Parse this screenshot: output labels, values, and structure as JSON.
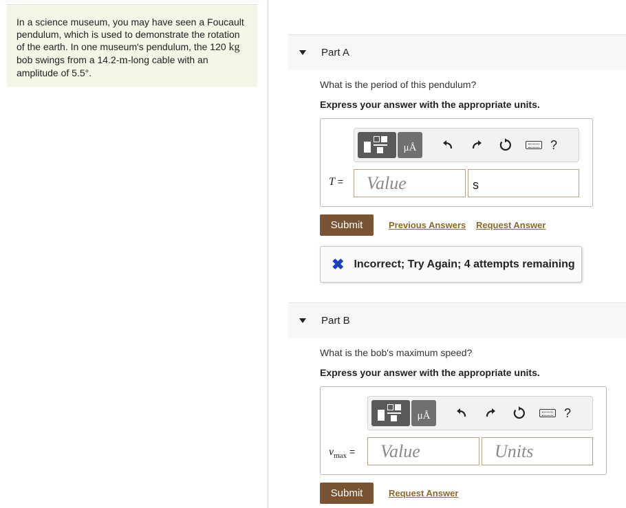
{
  "problem": {
    "text_1": "In a science museum, you may have seen a Foucault pendulum, which is used to demonstrate the rotation of the earth. In one museum's pendulum, the 120 ",
    "unit_kg": "kg",
    "text_2": " bob swings from a ",
    "length": "14.2-",
    "unit_m": "m",
    "text_3": "-long cable with an amplitude of 5.5°."
  },
  "part_a": {
    "title": "Part A",
    "question": "What is the period of this pendulum?",
    "instruction": "Express your answer with the appropriate units.",
    "var_symbol": "T",
    "var_eq": " =",
    "value_placeholder": "Value",
    "unit_value": "s",
    "submit_label": "Submit",
    "previous_answers_label": "Previous Answers",
    "request_answer_label": "Request Answer",
    "feedback": "Incorrect; Try Again; 4 attempts remaining"
  },
  "part_b": {
    "title": "Part B",
    "question": "What is the bob's maximum speed?",
    "instruction": "Express your answer with the appropriate units.",
    "var_symbol": "v",
    "var_sub": "max",
    "var_eq": " =",
    "value_placeholder": "Value",
    "units_placeholder": "Units",
    "submit_label": "Submit",
    "request_answer_label": "Request Answer"
  },
  "toolbar": {
    "mu_label": "μÅ",
    "help_label": "?"
  },
  "colors": {
    "submit_bg": "#7a5333",
    "link": "#8a6a2a",
    "incorrect_icon": "#1a3fc4",
    "problem_bg": "#f6f6e6"
  }
}
